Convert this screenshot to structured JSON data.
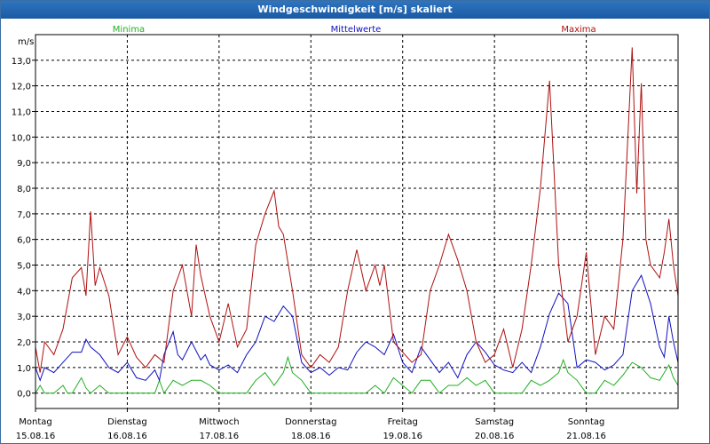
{
  "title": "Windgeschwindigkeit [m/s] skaliert",
  "chart_data": {
    "type": "line",
    "ylabel": "m/s",
    "ylim": [
      -0.6,
      14.0
    ],
    "yticks": [
      "0,0",
      "1,0",
      "2,0",
      "3,0",
      "4,0",
      "5,0",
      "6,0",
      "7,0",
      "8,0",
      "9,0",
      "10,0",
      "11,0",
      "12,0",
      "13,0"
    ],
    "ytick_values": [
      0,
      1,
      2,
      3,
      4,
      5,
      6,
      7,
      8,
      9,
      10,
      11,
      12,
      13
    ],
    "xlim": [
      0,
      7.0
    ],
    "xticks": [
      {
        "day": "Montag",
        "date": "15.08.16",
        "pos": 0
      },
      {
        "day": "Dienstag",
        "date": "16.08.16",
        "pos": 1
      },
      {
        "day": "Mittwoch",
        "date": "17.08.16",
        "pos": 2
      },
      {
        "day": "Donnerstag",
        "date": "18.08.16",
        "pos": 3
      },
      {
        "day": "Freitag",
        "date": "19.08.16",
        "pos": 4
      },
      {
        "day": "Samstag",
        "date": "20.08.16",
        "pos": 5
      },
      {
        "day": "Sonntag",
        "date": "21.08.16",
        "pos": 6
      }
    ],
    "grid": true,
    "legend_position": "top",
    "series": [
      {
        "name": "Minima",
        "color": "#22b022",
        "x": [
          0,
          0.05,
          0.1,
          0.2,
          0.3,
          0.35,
          0.4,
          0.5,
          0.55,
          0.6,
          0.7,
          0.8,
          0.9,
          1.0,
          1.1,
          1.2,
          1.3,
          1.35,
          1.4,
          1.5,
          1.6,
          1.7,
          1.8,
          1.9,
          2.0,
          2.1,
          2.2,
          2.3,
          2.4,
          2.5,
          2.6,
          2.7,
          2.75,
          2.8,
          2.9,
          3.0,
          3.1,
          3.2,
          3.3,
          3.4,
          3.5,
          3.6,
          3.7,
          3.8,
          3.9,
          4.0,
          4.1,
          4.2,
          4.3,
          4.4,
          4.5,
          4.6,
          4.7,
          4.8,
          4.9,
          5.0,
          5.1,
          5.2,
          5.3,
          5.4,
          5.5,
          5.6,
          5.7,
          5.75,
          5.8,
          5.9,
          6.0,
          6.1,
          6.2,
          6.3,
          6.4,
          6.5,
          6.6,
          6.7,
          6.8,
          6.85,
          6.9,
          6.95,
          7.0
        ],
        "values": [
          0.0,
          0.3,
          0.0,
          0.0,
          0.3,
          0.0,
          0.0,
          0.6,
          0.2,
          0.0,
          0.3,
          0.0,
          0.0,
          0.0,
          0.0,
          0.0,
          0.0,
          0.5,
          0.0,
          0.5,
          0.3,
          0.5,
          0.5,
          0.3,
          0.0,
          0.0,
          0.0,
          0.0,
          0.5,
          0.8,
          0.3,
          0.8,
          1.4,
          0.8,
          0.5,
          0.0,
          0.0,
          0.0,
          0.0,
          0.0,
          0.0,
          0.0,
          0.3,
          0.0,
          0.6,
          0.3,
          0.0,
          0.5,
          0.5,
          0.0,
          0.3,
          0.3,
          0.6,
          0.3,
          0.5,
          0.0,
          0.0,
          0.0,
          0.0,
          0.5,
          0.3,
          0.5,
          0.8,
          1.3,
          0.8,
          0.5,
          0.0,
          0.0,
          0.5,
          0.3,
          0.7,
          1.2,
          1.0,
          0.6,
          0.5,
          0.8,
          1.1,
          0.6,
          0.3
        ]
      },
      {
        "name": "Mittelwerte",
        "color": "#1010c0",
        "x": [
          0,
          0.05,
          0.1,
          0.2,
          0.3,
          0.4,
          0.5,
          0.55,
          0.6,
          0.7,
          0.8,
          0.9,
          1.0,
          1.1,
          1.2,
          1.3,
          1.35,
          1.4,
          1.5,
          1.55,
          1.6,
          1.7,
          1.8,
          1.85,
          1.9,
          2.0,
          2.1,
          2.2,
          2.3,
          2.4,
          2.5,
          2.6,
          2.7,
          2.8,
          2.9,
          3.0,
          3.1,
          3.2,
          3.3,
          3.4,
          3.5,
          3.6,
          3.7,
          3.8,
          3.9,
          4.0,
          4.1,
          4.2,
          4.3,
          4.4,
          4.5,
          4.6,
          4.7,
          4.8,
          4.9,
          5.0,
          5.1,
          5.2,
          5.3,
          5.4,
          5.5,
          5.6,
          5.7,
          5.8,
          5.9,
          6.0,
          6.1,
          6.2,
          6.3,
          6.4,
          6.5,
          6.6,
          6.7,
          6.8,
          6.85,
          6.9,
          6.95,
          7.0
        ],
        "values": [
          1.0,
          0.5,
          1.0,
          0.8,
          1.2,
          1.6,
          1.6,
          2.1,
          1.8,
          1.5,
          1.0,
          0.8,
          1.2,
          0.6,
          0.5,
          0.9,
          0.5,
          1.5,
          2.4,
          1.5,
          1.3,
          2.0,
          1.3,
          1.5,
          1.1,
          0.9,
          1.1,
          0.8,
          1.5,
          2.0,
          3.0,
          2.8,
          3.4,
          3.0,
          1.2,
          0.8,
          1.0,
          0.7,
          1.0,
          0.9,
          1.6,
          2.0,
          1.8,
          1.5,
          2.3,
          1.2,
          0.8,
          1.8,
          1.3,
          0.8,
          1.2,
          0.6,
          1.5,
          2.0,
          1.6,
          1.1,
          0.9,
          0.8,
          1.2,
          0.8,
          1.8,
          3.1,
          3.9,
          3.5,
          1.0,
          1.3,
          1.2,
          0.9,
          1.1,
          1.5,
          4.0,
          4.6,
          3.5,
          1.8,
          1.4,
          3.0,
          2.0,
          1.2
        ]
      },
      {
        "name": "Maxima",
        "color": "#b01010",
        "x": [
          0,
          0.05,
          0.1,
          0.2,
          0.3,
          0.4,
          0.5,
          0.55,
          0.6,
          0.65,
          0.7,
          0.8,
          0.9,
          1.0,
          1.1,
          1.2,
          1.3,
          1.4,
          1.5,
          1.6,
          1.7,
          1.75,
          1.8,
          1.9,
          2.0,
          2.1,
          2.2,
          2.3,
          2.4,
          2.5,
          2.6,
          2.65,
          2.7,
          2.8,
          2.9,
          3.0,
          3.1,
          3.2,
          3.3,
          3.4,
          3.5,
          3.6,
          3.7,
          3.75,
          3.8,
          3.9,
          4.0,
          4.1,
          4.2,
          4.3,
          4.4,
          4.5,
          4.6,
          4.7,
          4.8,
          4.9,
          5.0,
          5.1,
          5.2,
          5.3,
          5.4,
          5.5,
          5.6,
          5.7,
          5.8,
          5.9,
          6.0,
          6.1,
          6.2,
          6.3,
          6.4,
          6.5,
          6.55,
          6.6,
          6.65,
          6.7,
          6.8,
          6.85,
          6.9,
          6.95,
          7.0
        ],
        "values": [
          1.8,
          0.8,
          2.0,
          1.5,
          2.5,
          4.5,
          4.9,
          3.8,
          7.1,
          4.2,
          4.9,
          3.8,
          1.5,
          2.2,
          1.4,
          1.0,
          1.5,
          1.2,
          4.0,
          5.0,
          3.0,
          5.8,
          4.6,
          3.0,
          2.0,
          3.5,
          1.8,
          2.5,
          5.8,
          7.0,
          7.9,
          6.5,
          6.2,
          4.0,
          1.5,
          1.0,
          1.5,
          1.2,
          1.8,
          4.0,
          5.6,
          4.0,
          5.0,
          4.2,
          5.0,
          2.0,
          1.6,
          1.2,
          1.5,
          4.0,
          5.0,
          6.2,
          5.2,
          4.0,
          2.0,
          1.2,
          1.5,
          2.5,
          1.0,
          2.5,
          5.0,
          8.0,
          12.2,
          5.0,
          2.0,
          3.0,
          5.5,
          1.5,
          3.0,
          2.5,
          6.0,
          13.5,
          7.8,
          12.1,
          6.0,
          5.0,
          4.5,
          5.5,
          6.8,
          5.0,
          3.8
        ]
      }
    ]
  }
}
